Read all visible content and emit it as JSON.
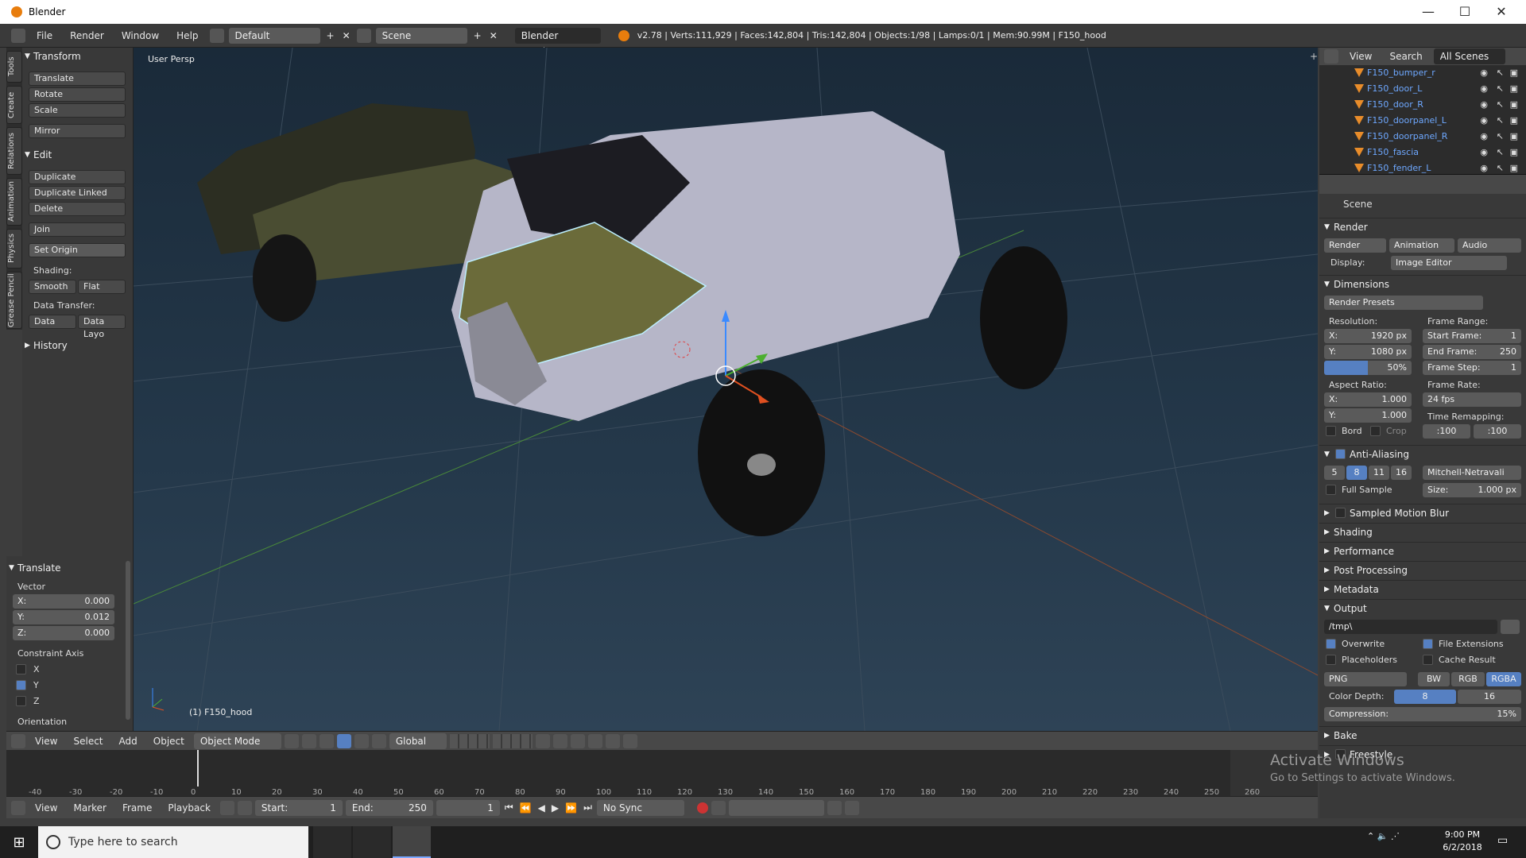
{
  "window": {
    "title": "Blender",
    "minimize": "—",
    "maximize": "☐",
    "close": "✕"
  },
  "menu": [
    "File",
    "Render",
    "Window",
    "Help"
  ],
  "screen_layout": "Default",
  "scene": "Scene",
  "engine": "Blender Render",
  "stats": "v2.78 | Verts:111,929 | Faces:142,804 | Tris:142,804 | Objects:1/98 | Lamps:0/1 | Mem:90.99M | F150_hood",
  "tabs": [
    "Tools",
    "Create",
    "Relations",
    "Animation",
    "Physics",
    "Grease Pencil"
  ],
  "toolshelf": {
    "transform": "Transform",
    "translate": "Translate",
    "rotate": "Rotate",
    "scale": "Scale",
    "mirror": "Mirror",
    "edit": "Edit",
    "duplicate": "Duplicate",
    "duplicate_linked": "Duplicate Linked",
    "delete": "Delete",
    "join": "Join",
    "set_origin": "Set Origin",
    "shading": "Shading:",
    "smooth": "Smooth",
    "flat": "Flat",
    "data_transfer": "Data Transfer:",
    "data": "Data",
    "data_layo": "Data Layo",
    "history": "History"
  },
  "lastop": {
    "title": "Translate",
    "vector": "Vector",
    "x_label": "X:",
    "x": "0.000",
    "y_label": "Y:",
    "y": "0.012",
    "z_label": "Z:",
    "z": "0.000",
    "constraint": "Constraint Axis",
    "cx": "X",
    "cy": "Y",
    "cz": "Z",
    "orientation": "Orientation"
  },
  "viewport": {
    "view_name": "User Persp",
    "object_label": "(1) F150_hood"
  },
  "vpheader": {
    "view": "View",
    "select": "Select",
    "add": "Add",
    "object": "Object",
    "mode": "Object Mode",
    "orientation": "Global"
  },
  "timeline": {
    "ticks": [
      "-40",
      "-30",
      "-20",
      "-10",
      "0",
      "10",
      "20",
      "30",
      "40",
      "50",
      "60",
      "70",
      "80",
      "90",
      "100",
      "110",
      "120",
      "130",
      "140",
      "150",
      "160",
      "170",
      "180",
      "190",
      "200",
      "210",
      "220",
      "230",
      "240",
      "250",
      "260"
    ]
  },
  "tlheader": {
    "view": "View",
    "marker": "Marker",
    "frame": "Frame",
    "playback": "Playback",
    "start_label": "Start:",
    "start": "1",
    "end_label": "End:",
    "end": "250",
    "current": "1",
    "sync": "No Sync"
  },
  "outliner": {
    "view": "View",
    "search": "Search",
    "all_scenes": "All Scenes",
    "items": [
      "F150_bumper_r",
      "F150_door_L",
      "F150_door_R",
      "F150_doorpanel_L",
      "F150_doorpanel_R",
      "F150_fascia",
      "F150_fender_L"
    ]
  },
  "props": {
    "scene": "Scene",
    "render": "Render",
    "render_btn": "Render",
    "animation_btn": "Animation",
    "audio_btn": "Audio",
    "display_label": "Display:",
    "display": "Image Editor",
    "dimensions": "Dimensions",
    "presets": "Render Presets",
    "resolution": "Resolution:",
    "res_x_label": "X:",
    "res_x": "1920 px",
    "res_y_label": "Y:",
    "res_y": "1080 px",
    "res_pct": "50%",
    "frame_range": "Frame Range:",
    "start_frame_label": "Start Frame:",
    "start_frame": "1",
    "end_frame_label": "End Frame:",
    "end_frame": "250",
    "frame_step_label": "Frame Step:",
    "frame_step": "1",
    "aspect": "Aspect Ratio:",
    "asp_x_label": "X:",
    "asp_x": "1.000",
    "asp_y_label": "Y:",
    "asp_y": "1.000",
    "frame_rate": "Frame Rate:",
    "fps": "24 fps",
    "time_remap": "Time Remapping:",
    "remap_old": ":100",
    "remap_new": ":100",
    "bord": "Bord",
    "crop": "Crop",
    "aa": "Anti-Aliasing",
    "aa5": "5",
    "aa8": "8",
    "aa11": "11",
    "aa16": "16",
    "filter": "Mitchell-Netravali",
    "full_sample": "Full Sample",
    "size_label": "Size:",
    "size": "1.000 px",
    "motion_blur": "Sampled Motion Blur",
    "shading": "Shading",
    "performance": "Performance",
    "post": "Post Processing",
    "metadata": "Metadata",
    "output": "Output",
    "path": "/tmp\\",
    "overwrite": "Overwrite",
    "file_ext": "File Extensions",
    "placeholders": "Placeholders",
    "cache": "Cache Result",
    "format": "PNG",
    "bw": "BW",
    "rgb": "RGB",
    "rgba": "RGBA",
    "color_depth": "Color Depth:",
    "depth8": "8",
    "depth16": "16",
    "compression": "Compression:",
    "compression_val": "15%",
    "bake": "Bake",
    "freestyle": "Freestyle"
  },
  "watermark": {
    "line1": "Activate Windows",
    "line2": "Go to Settings to activate Windows."
  },
  "taskbar": {
    "search": "Type here to search",
    "time": "9:00 PM",
    "date": "6/2/2018"
  },
  "colors": {
    "accent": "#5680c2",
    "hood": "#6b6b3a",
    "truck": "#b6b6c8"
  }
}
